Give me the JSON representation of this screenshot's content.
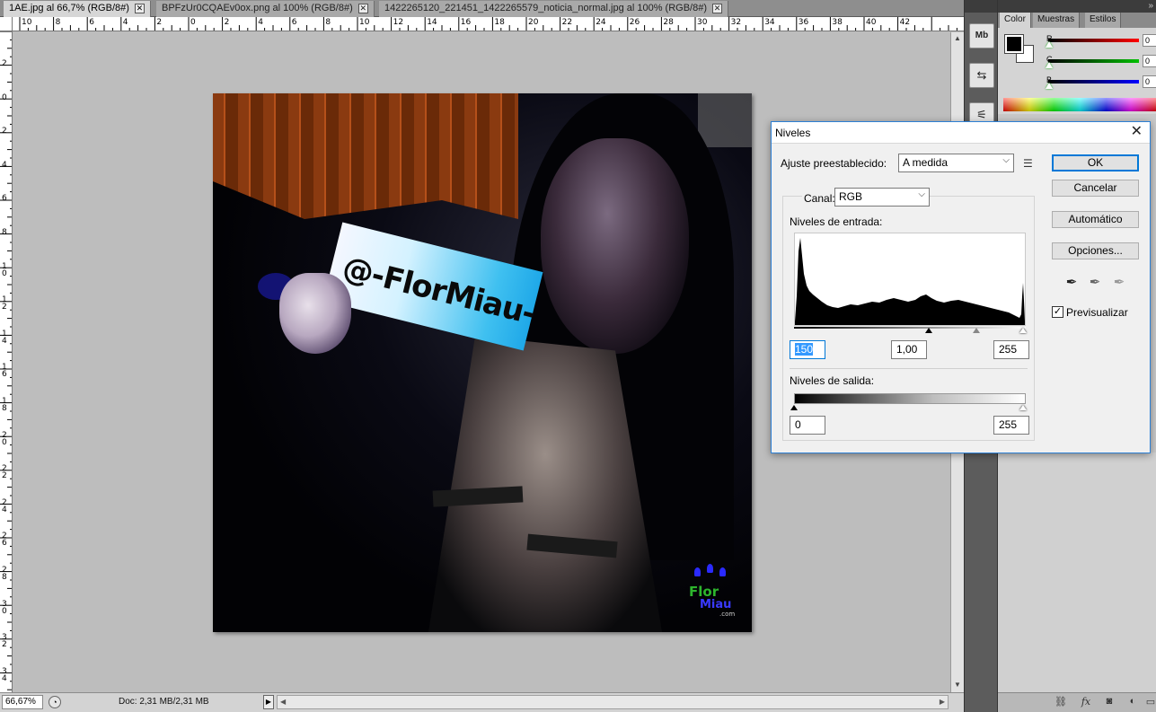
{
  "tabs": [
    {
      "label": "1AE.jpg al 66,7% (RGB/8#)",
      "active": true
    },
    {
      "label": "BPFzUr0CQAEv0ox.png al 100% (RGB/8#)",
      "active": false
    },
    {
      "label": "1422265120_221451_1422265579_noticia_normal.jpg al 100% (RGB/8#)",
      "active": false
    }
  ],
  "ruler": {
    "h_labels": [
      "10",
      "8",
      "6",
      "4",
      "2",
      "0",
      "2",
      "4",
      "6",
      "8",
      "10",
      "12",
      "14",
      "16",
      "18",
      "20",
      "22",
      "24",
      "26",
      "28",
      "30",
      "32",
      "34",
      "36",
      "38",
      "40",
      "42"
    ],
    "v_labels": [
      "2",
      "0",
      "2",
      "4",
      "6",
      "8",
      "1 0",
      "1 2",
      "1 4",
      "1 6",
      "1 8",
      "2 0",
      "2 2",
      "2 4",
      "2 6",
      "2 8",
      "3 0",
      "3 2",
      "3 4"
    ]
  },
  "image": {
    "sign_text": "@-FlorMiau-",
    "watermark_line1": "Flor",
    "watermark_line2": "Miau",
    "watermark_line3": ".com"
  },
  "status": {
    "zoom": "66,67%",
    "doc": "Doc: 2,31 MB/2,31 MB"
  },
  "panel": {
    "tabs": [
      "Color",
      "Muestras",
      "Estilos"
    ],
    "active_tab": "Color",
    "sliders": [
      {
        "label": "R",
        "value": "0",
        "color": "#ff0000"
      },
      {
        "label": "G",
        "value": "0",
        "color": "#00c000"
      },
      {
        "label": "B",
        "value": "0",
        "color": "#0000ff"
      }
    ],
    "foreground": "#000000",
    "background": "#ffffff"
  },
  "dialog": {
    "title": "Niveles",
    "preset_label": "Ajuste preestablecido:",
    "preset_value": "A medida",
    "channel_label": "Canal:",
    "channel_value": "RGB",
    "input_label": "Niveles de entrada:",
    "input_black": "150",
    "input_gamma": "1,00",
    "input_white": "255",
    "output_label": "Niveles de salida:",
    "output_black": "0",
    "output_white": "255",
    "buttons": {
      "ok": "OK",
      "cancel": "Cancelar",
      "auto": "Automático",
      "options": "Opciones..."
    },
    "preview_label": "Previsualizar",
    "preview_checked": true
  }
}
